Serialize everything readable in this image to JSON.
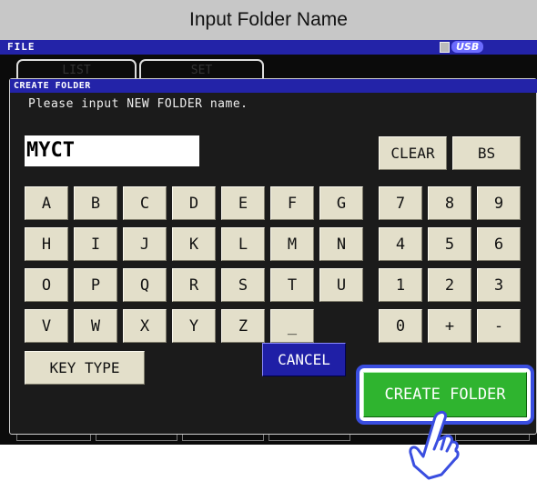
{
  "caption": "Input Folder Name",
  "filebar": {
    "title": "FILE",
    "usb_label": "USB"
  },
  "background_tabs": {
    "tab1": "LIST",
    "tab2": "SET"
  },
  "dialog": {
    "title": "CREATE FOLDER",
    "prompt": "Please input NEW FOLDER name.",
    "folder_name": "MYCT"
  },
  "keys": {
    "clear": "CLEAR",
    "backspace": "BS",
    "letters": [
      "A",
      "B",
      "C",
      "D",
      "E",
      "F",
      "G",
      "H",
      "I",
      "J",
      "K",
      "L",
      "M",
      "N",
      "O",
      "P",
      "Q",
      "R",
      "S",
      "T",
      "U",
      "V",
      "W",
      "X",
      "Y",
      "Z",
      "_"
    ],
    "numpad": [
      "7",
      "8",
      "9",
      "4",
      "5",
      "6",
      "1",
      "2",
      "3",
      "0",
      "+",
      "-"
    ],
    "key_type": "KEY TYPE",
    "cancel": "CANCEL",
    "create_folder": "CREATE FOLDER"
  },
  "icons": {
    "pointer": "pointing-hand-icon",
    "usb": "usb-icon"
  },
  "colors": {
    "title_bar": "#2323a8",
    "key_face": "#e3dfca",
    "cancel_button": "#1f1fa6",
    "create_button": "#2fb42f",
    "highlight_frame": "#3a4ee0"
  }
}
